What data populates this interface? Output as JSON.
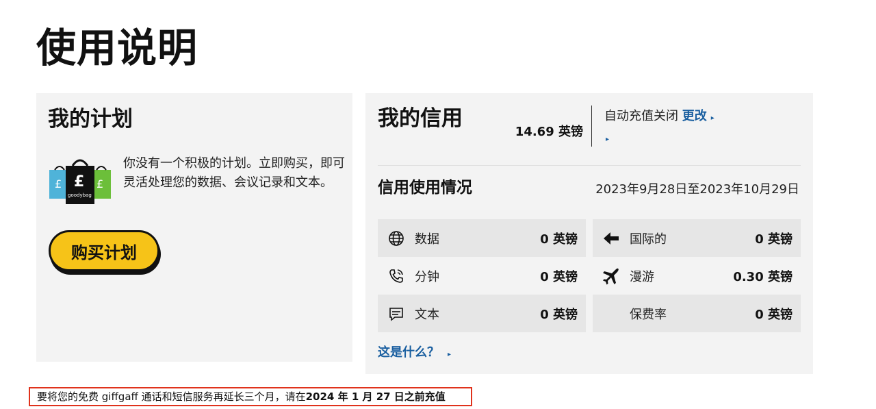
{
  "page_title": "使用说明",
  "plan": {
    "heading": "我的计划",
    "logo_text": "goodybag",
    "description": "你没有一个积极的计划。立即购买，即可灵活处理您的数据、会议记录和文本。",
    "buy_button": "购买计划"
  },
  "credit": {
    "heading": "我的信用",
    "balance": "14.69 英镑",
    "auto_topup_label": "自动充值关闭",
    "change_link": "更改",
    "usage_heading": "信用使用情况",
    "period": "2023年9月28日至2023年10月29日",
    "usage": [
      {
        "icon": "globe-icon",
        "label": "数据",
        "value": "0 英镑"
      },
      {
        "icon": "arrow-left-icon",
        "label": "国际的",
        "value": "0 英镑"
      },
      {
        "icon": "phone-icon",
        "label": "分钟",
        "value": "0 英镑"
      },
      {
        "icon": "plane-icon",
        "label": "漫游",
        "value": "0.30 英镑"
      },
      {
        "icon": "chat-icon",
        "label": "文本",
        "value": "0 英镑"
      },
      {
        "icon": "",
        "label": "保费率",
        "value": "0 英镑"
      }
    ],
    "whats_this": "这是什么？"
  },
  "notice": {
    "text": "要将您的免费 giffgaff 通话和短信服务再延长三个月，请在",
    "bold": "2024 年 1 月 27 日之前充值"
  },
  "colors": {
    "accent": "#1a5fa0",
    "button": "#f6c318",
    "card_bg": "#f3f3f3",
    "notice_border": "#e0321c"
  }
}
